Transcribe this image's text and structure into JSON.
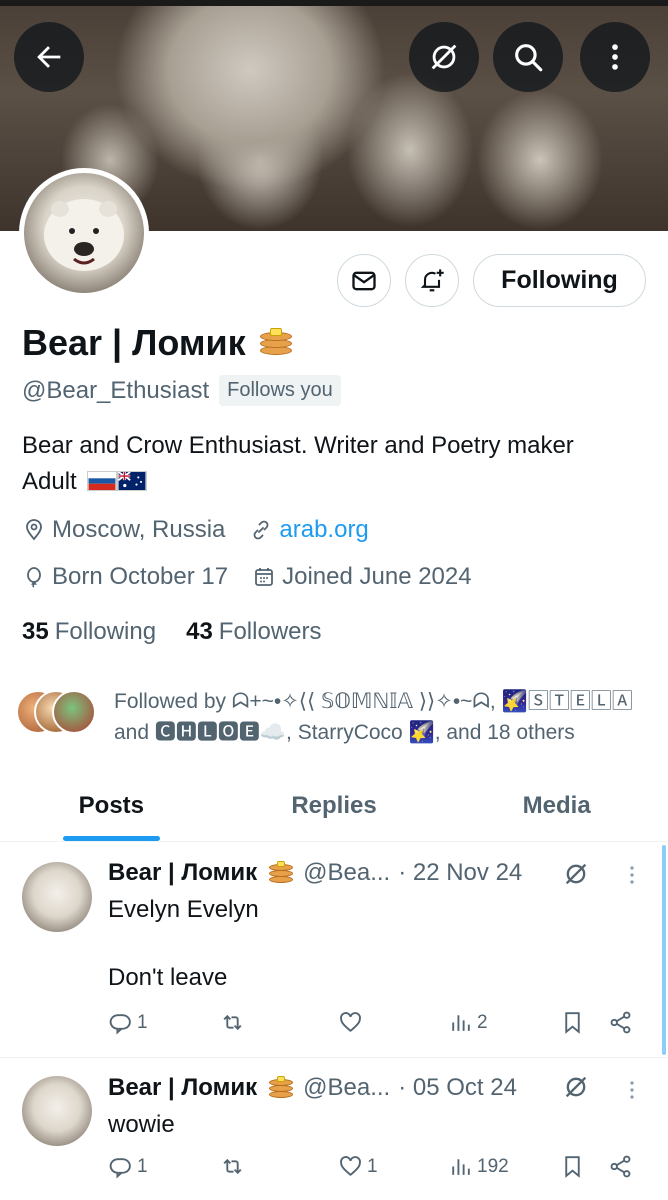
{
  "colors": {
    "accent": "#1d9bf0",
    "text_primary": "#0f1419",
    "text_secondary": "#536471",
    "border": "#cfd9de"
  },
  "icons": {
    "back": "arrow-left-icon",
    "grok": "grok-icon",
    "search": "search-icon",
    "more": "more-vertical-icon",
    "message": "envelope-icon",
    "notify": "bell-plus-icon",
    "location": "location-pin-icon",
    "link": "link-icon",
    "birthday": "balloon-icon",
    "joined": "calendar-icon",
    "reply": "reply-icon",
    "retweet": "retweet-icon",
    "like": "heart-icon",
    "views": "views-icon",
    "bookmark": "bookmark-icon",
    "share": "share-icon"
  },
  "profile": {
    "name": "Bear | Ломик",
    "handle": "@Bear_Ethusiast",
    "follows_you": "Follows you",
    "bio_line1": "Bear and Crow Enthusiast. Writer and Poetry maker",
    "bio_line2": "Adult",
    "location": "Moscow, Russia",
    "website": "arab.org",
    "born": "Born October 17",
    "joined": "Joined June 2024",
    "following_count": "35",
    "following_label": "Following",
    "followers_count": "43",
    "followers_label": "Followers",
    "following_button": "Following"
  },
  "followed_by": {
    "line1": "Followed by ᗣ+~•✧⟨⟨ 𝕊𝕆𝕄ℕ𝕀𝔸 ⟩⟩✧•~ᗣ, 🌠🅂🅃🄴🄻🄰",
    "line2": "and 🅲🅷🅻🅾🅴☁️, StarryCoco 🌠, and 18 others"
  },
  "tabs": [
    {
      "label": "Posts",
      "active": true
    },
    {
      "label": "Replies",
      "active": false
    },
    {
      "label": "Media",
      "active": false
    }
  ],
  "tweets": [
    {
      "name": "Bear | Ломик",
      "handle": "@Bea...",
      "date": "· 22 Nov 24",
      "line1": "Evelyn Evelyn",
      "line2": "Don't leave",
      "replies": "1",
      "retweets": "",
      "likes": "",
      "views": "2"
    },
    {
      "name": "Bear | Ломик",
      "handle": "@Bea...",
      "date": "· 05 Oct 24",
      "line1": "wowie",
      "line2": "",
      "replies": "1",
      "retweets": "",
      "likes": "1",
      "views": "192"
    }
  ]
}
